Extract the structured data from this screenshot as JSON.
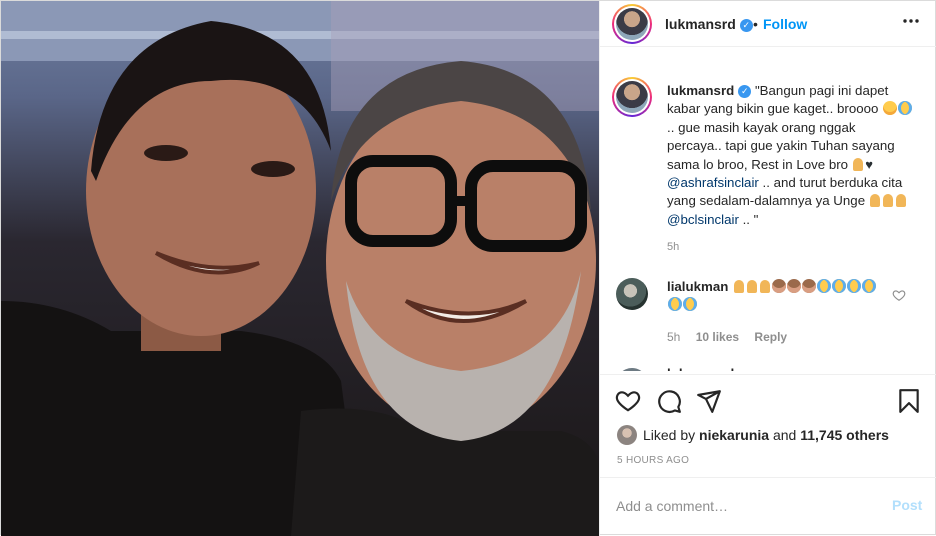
{
  "header": {
    "username": "lukmansrd",
    "separator": "•",
    "follow_label": "Follow"
  },
  "caption": {
    "username": "lukmansrd",
    "text_1": "\"Bangun pagi ini dapet kabar yang bikin gue kaget.. broooo",
    "text_2": ".. gue masih kayak orang nggak percaya.. tapi gue yakin Tuhan sayang sama lo broo, Rest in Love bro",
    "mention_1": "@ashrafsinclair",
    "text_3": ".. and turut berduka cita yang sedalam-dalamnya ya Unge",
    "mention_2": "@bclsinclair",
    "text_4": ".. \"",
    "time": "5h"
  },
  "comment": {
    "username": "lialukman",
    "emojis": [
      "pray",
      "pray",
      "pray",
      "monkey",
      "monkey",
      "monkey",
      "cry",
      "cry",
      "cry",
      "cry",
      "cry",
      "cry"
    ],
    "time": "5h",
    "likes": "10 likes",
    "reply": "Reply"
  },
  "next_comment": {
    "username": "lukmansrd"
  },
  "likes": {
    "prefix": "Liked by",
    "user": "niekarunia",
    "conjunction": "and",
    "others": "11,745 others"
  },
  "timestamp": "5 HOURS AGO",
  "add_comment": {
    "placeholder": "Add a comment…",
    "post_label": "Post"
  },
  "icons": {
    "more": "more-options-icon",
    "like": "heart-icon",
    "comment": "comment-icon",
    "share": "share-icon",
    "save": "bookmark-icon",
    "verified": "verified-badge-icon"
  }
}
